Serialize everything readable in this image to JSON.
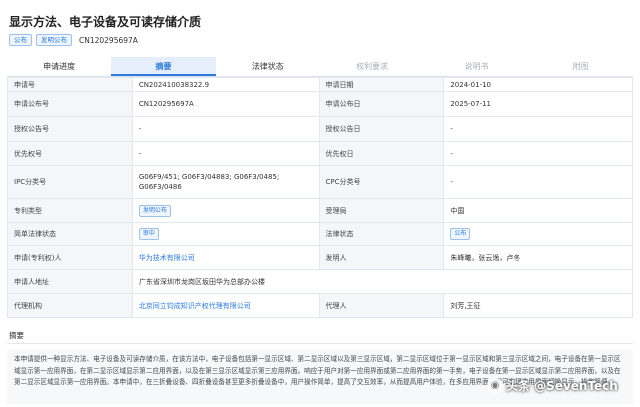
{
  "header": {
    "title": "显示方法、电子设备及可读存储介质",
    "badge_status": "公布",
    "badge_type": "发明公布",
    "pub_number": "CN120295697A"
  },
  "tabs": [
    {
      "label": "申请进度",
      "state": "normal"
    },
    {
      "label": "摘要",
      "state": "active"
    },
    {
      "label": "法律状态",
      "state": "normal"
    },
    {
      "label": "权利要求",
      "state": "disabled"
    },
    {
      "label": "说明书",
      "state": "disabled"
    },
    {
      "label": "附图",
      "state": "disabled"
    }
  ],
  "fields": {
    "app_no_label": "申请号",
    "app_no": "CN202410038322.9",
    "app_date_label": "申请日期",
    "app_date": "2024-01-10",
    "pub_no_label": "申请公布号",
    "pub_no": "CN120295697A",
    "pub_date_label": "申请公布日",
    "pub_date": "2025-07-11",
    "grant_no_label": "授权公告号",
    "grant_no": "-",
    "grant_date_label": "授权公告日",
    "grant_date": "-",
    "priority_no_label": "优先权号",
    "priority_no": "-",
    "priority_date_label": "优先权日",
    "priority_date": "-",
    "ipc_label": "IPC分类号",
    "ipc": "G06F9/451; G06F3/04883; G06F3/0485; G06F3/0486",
    "cpc_label": "CPC分类号",
    "cpc": "-",
    "patent_type_label": "专利类型",
    "patent_type": "发明公布",
    "office_label": "受理局",
    "office": "中国",
    "brief_status_label": "简单法律状态",
    "brief_status": "审中",
    "legal_status_label": "法律状态",
    "legal_status": "公布",
    "applicant_label": "申请(专利权)人",
    "applicant": "华为技术有限公司",
    "inventor_label": "发明人",
    "inventor": "朱峰曦，张云逸，卢冬",
    "address_label": "申请人地址",
    "address": "广东省深圳市龙岗区坂田华为总部办公楼",
    "agency_label": "代理机构",
    "agency": "北京同立钧成知识产权代理有限公司",
    "agent_label": "代理人",
    "agent": "刘芳,王征"
  },
  "abstract": {
    "heading": "摘要",
    "text": "本申请提供一种显示方法、电子设备及可读存储介质，在该方法中，电子设备包括第一显示区域、第二显示区域以及第三显示区域，第二显示区域位于第一显示区域和第三显示区域之间，电子设备在第一显示区域显示第一应用界面，在第二显示区域显示第二应用界面，以及在第三显示区域显示第三应用界面。响应于用户对第一应用界面或第二应用界面的第一手势，电子设备在第一显示区域显示第二应用界面，以及在第二显示区域显示第一应用界面。本申请中，在三折叠设备、四折叠设备甚至更多折叠设备中，用户操作简单，提高了交互效率，从而提高用户体验，在多应用界面，即可实现应用界面切换显示，操作简便。"
  },
  "watermark": {
    "text": "头条 @SevenTech"
  }
}
